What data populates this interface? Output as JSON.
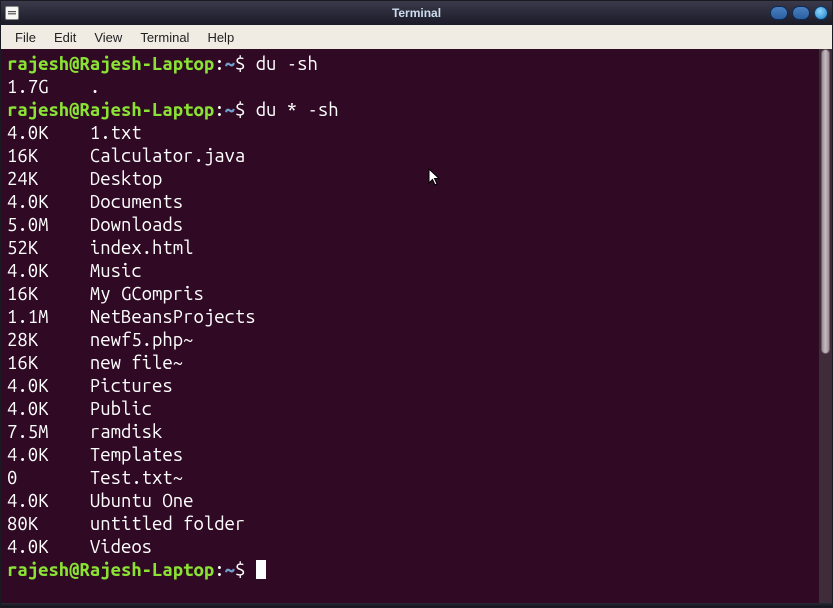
{
  "titlebar": {
    "title": "Terminal"
  },
  "menubar": {
    "items": [
      "File",
      "Edit",
      "View",
      "Terminal",
      "Help"
    ]
  },
  "prompt": {
    "user_host": "rajesh@Rajesh-Laptop",
    "sep1": ":",
    "path": "~",
    "dollar": "$ "
  },
  "cmd1": "du -sh",
  "cmd2": "du * -sh",
  "out_total": {
    "size": "1.7G",
    "name": "."
  },
  "out_files": [
    {
      "size": "4.0K",
      "name": "1.txt"
    },
    {
      "size": "16K",
      "name": "Calculator.java"
    },
    {
      "size": "24K",
      "name": "Desktop"
    },
    {
      "size": "4.0K",
      "name": "Documents"
    },
    {
      "size": "5.0M",
      "name": "Downloads"
    },
    {
      "size": "52K",
      "name": "index.html"
    },
    {
      "size": "4.0K",
      "name": "Music"
    },
    {
      "size": "16K",
      "name": "My GCompris"
    },
    {
      "size": "1.1M",
      "name": "NetBeansProjects"
    },
    {
      "size": "28K",
      "name": "newf5.php~"
    },
    {
      "size": "16K",
      "name": "new file~"
    },
    {
      "size": "4.0K",
      "name": "Pictures"
    },
    {
      "size": "4.0K",
      "name": "Public"
    },
    {
      "size": "7.5M",
      "name": "ramdisk"
    },
    {
      "size": "4.0K",
      "name": "Templates"
    },
    {
      "size": "0",
      "name": "Test.txt~"
    },
    {
      "size": "4.0K",
      "name": "Ubuntu One"
    },
    {
      "size": "80K",
      "name": "untitled folder"
    },
    {
      "size": "4.0K",
      "name": "Videos"
    }
  ]
}
